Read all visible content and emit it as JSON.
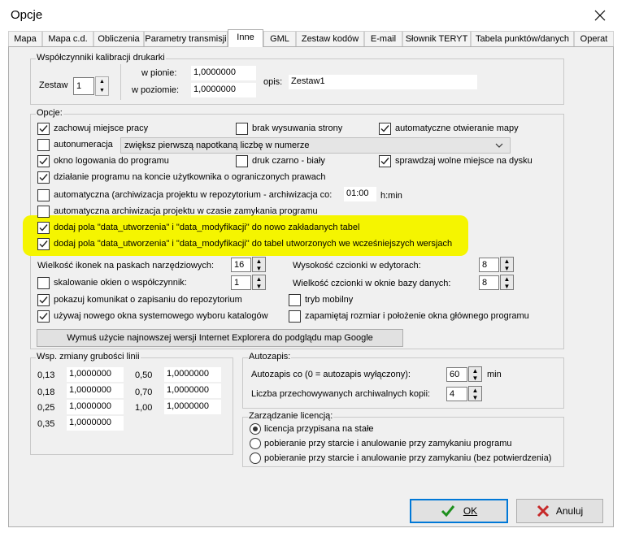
{
  "window": {
    "title": "Opcje"
  },
  "tabs": [
    "Mapa",
    "Mapa c.d.",
    "Obliczenia",
    "Parametry transmisji",
    "Inne",
    "GML",
    "Zestaw kodów",
    "E-mail",
    "Słownik TERYT",
    "Tabela punktów/danych",
    "Operat"
  ],
  "active_tab": "Inne",
  "calib": {
    "group": "Współczynniki kalibracji drukarki",
    "zestaw_label": "Zestaw",
    "zestaw_value": "1",
    "pion_label": "w pionie:",
    "pion_value": "1,0000000",
    "poziom_label": "w poziomie:",
    "poziom_value": "1,0000000",
    "opis_label": "opis:",
    "opis_value": "Zestaw1"
  },
  "options": {
    "group": "Opcje:",
    "c1": "zachowuj miejsce pracy",
    "c2": "brak wysuwania strony",
    "c3": "automatyczne otwieranie mapy",
    "c4": "autonumeracja",
    "c4_dropdown": "zwiększ pierwszą napotkaną liczbę w numerze",
    "c5": "okno logowania do programu",
    "c6": "druk czarno - biały",
    "c7": "sprawdzaj wolne miejsce na dysku",
    "c8": "działanie programu na koncie użytkownika o ograniczonych prawach",
    "c9": "automatyczna (archiwizacja projektu w repozytorium - archiwizacja co:",
    "c9_time": "01:00",
    "c9_unit": "h:min",
    "c10": "automatyczna archiwizacja projektu w czasie zamykania programu",
    "c11": "dodaj pola \"data_utworzenia\" i \"data_modyfikacji\" do nowo zakładanych tabel",
    "c12": "dodaj pola \"data_utworzenia\" i \"data_modyfikacji\" do tabel utworzonych we wcześniejszych wersjach",
    "icon_size_label": "Wielkość ikonek na paskach narzędziowych:",
    "icon_size_value": "16",
    "edit_font_label": "Wysokość czcionki w edytorach:",
    "edit_font_value": "8",
    "scale_label": "skalowanie okien o współczynnik:",
    "scale_value": "1",
    "db_font_label": "Wielkość czcionki w oknie bazy danych:",
    "db_font_value": "8",
    "c13": "pokazuj komunikat o zapisaniu do repozytorium",
    "c14": "tryb mobilny",
    "c15": "używaj nowego okna systemowego wyboru katalogów",
    "c16": "zapamiętaj rozmiar i położenie okna głównego programu",
    "ie_button": "Wymuś użycie najnowszej wersji Internet Explorera do podglądu map Google"
  },
  "lines": {
    "group": "Wsp. zmiany grubości linii",
    "rows": [
      {
        "k": "0,13",
        "v": "1,0000000"
      },
      {
        "k": "0,18",
        "v": "1,0000000"
      },
      {
        "k": "0,25",
        "v": "1,0000000"
      },
      {
        "k": "0,35",
        "v": "1,0000000"
      },
      {
        "k": "0,50",
        "v": "1,0000000"
      },
      {
        "k": "0,70",
        "v": "1,0000000"
      },
      {
        "k": "1,00",
        "v": "1,0000000"
      }
    ]
  },
  "autosave": {
    "group": "Autozapis:",
    "every_label": "Autozapis co (0 = autozapis wyłączony):",
    "every_value": "60",
    "every_unit": "min",
    "copies_label": "Liczba przechowywanych archiwalnych kopii:",
    "copies_value": "4"
  },
  "license": {
    "group": "Zarządzanie licencją:",
    "r1": "licencja przypisana na stałe",
    "r2": "pobieranie przy starcie i anulowanie przy zamykaniu programu",
    "r3": "pobieranie przy starcie i anulowanie przy zamykaniu (bez potwierdzenia)"
  },
  "buttons": {
    "ok": "OK",
    "cancel": "Anuluj"
  },
  "colors": {
    "highlight": "#f5f500",
    "ok_check": "#1e8f1e",
    "cancel_x": "#c62828"
  }
}
